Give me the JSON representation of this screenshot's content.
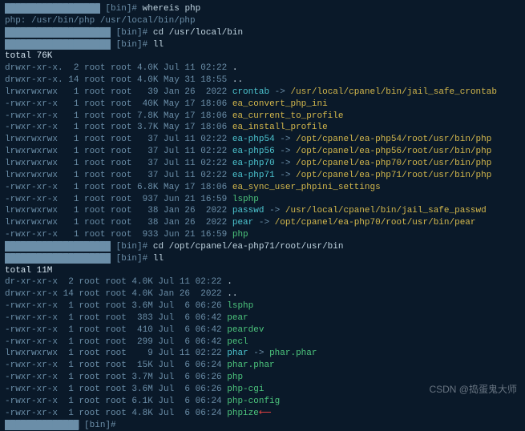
{
  "redact1": "██████████████████",
  "redact2": "████████████████████",
  "redact3": "████████████████████",
  "redact4": "██████████████",
  "redact5": "████████████████████",
  "redact6": "██████████████",
  "prompt_bin": " [bin]# ",
  "cmd_whereis": "whereis php",
  "whereis_out": "php: /usr/bin/php /usr/local/bin/php",
  "cmd_cd1": "cd /usr/local/bin",
  "cmd_ll": "ll",
  "total1": "total 76K",
  "l1": {
    "p": "drwxr-xr-x.  2 root root 4.0K Jul 11 02:22 ",
    "n": "."
  },
  "l2": {
    "p": "drwxr-xr-x. 14 root root 4.0K May 31 18:55 ",
    "n": ".."
  },
  "l3": {
    "p": "lrwxrwxrwx   1 root root   39 Jan 26  2022 ",
    "n": "crontab",
    "a": " -> ",
    "t": "/usr/local/cpanel/bin/jail_safe_crontab"
  },
  "l4": {
    "p": "-rwxr-xr-x   1 root root  40K May 17 18:06 ",
    "n": "ea_convert_php_ini"
  },
  "l5": {
    "p": "-rwxr-xr-x   1 root root 7.8K May 17 18:06 ",
    "n": "ea_current_to_profile"
  },
  "l6": {
    "p": "-rwxr-xr-x   1 root root 3.7K May 17 18:06 ",
    "n": "ea_install_profile"
  },
  "l7": {
    "p": "lrwxrwxrwx   1 root root   37 Jul 11 02:22 ",
    "n": "ea-php54",
    "a": " -> ",
    "t": "/opt/cpanel/ea-php54/root/usr/bin/php"
  },
  "l8": {
    "p": "lrwxrwxrwx   1 root root   37 Jul 11 02:22 ",
    "n": "ea-php56",
    "a": " -> ",
    "t": "/opt/cpanel/ea-php56/root/usr/bin/php"
  },
  "l9": {
    "p": "lrwxrwxrwx   1 root root   37 Jul 11 02:22 ",
    "n": "ea-php70",
    "a": " -> ",
    "t": "/opt/cpanel/ea-php70/root/usr/bin/php"
  },
  "l10": {
    "p": "lrwxrwxrwx   1 root root   37 Jul 11 02:22 ",
    "n": "ea-php71",
    "a": " -> ",
    "t": "/opt/cpanel/ea-php71/root/usr/bin/php"
  },
  "l11": {
    "p": "-rwxr-xr-x   1 root root 6.8K May 17 18:06 ",
    "n": "ea_sync_user_phpini_settings"
  },
  "l12": {
    "p": "-rwxr-xr-x   1 root root  937 Jun 21 16:59 ",
    "n": "lsphp"
  },
  "l13": {
    "p": "lrwxrwxrwx   1 root root   38 Jan 26  2022 ",
    "n": "passwd",
    "a": " -> ",
    "t": "/usr/local/cpanel/bin/jail_safe_passwd"
  },
  "l14": {
    "p": "lrwxrwxrwx   1 root root   38 Jan 26  2022 ",
    "n": "pear",
    "a": " -> ",
    "t": "/opt/cpanel/ea-php70/root/usr/bin/pear"
  },
  "l15": {
    "p": "-rwxr-xr-x   1 root root  933 Jun 21 16:59 ",
    "n": "php"
  },
  "cmd_cd2": "cd /opt/cpanel/ea-php71/root/usr/bin",
  "total2": "total 11M",
  "m1": {
    "p": "dr-xr-xr-x  2 root root 4.0K Jul 11 02:22 ",
    "n": "."
  },
  "m2": {
    "p": "drwxr-xr-x 14 root root 4.0K Jan 26  2022 ",
    "n": ".."
  },
  "m3": {
    "p": "-rwxr-xr-x  1 root root 3.6M Jul  6 06:26 ",
    "n": "lsphp"
  },
  "m4": {
    "p": "-rwxr-xr-x  1 root root  383 Jul  6 06:42 ",
    "n": "pear"
  },
  "m5": {
    "p": "-rwxr-xr-x  1 root root  410 Jul  6 06:42 ",
    "n": "peardev"
  },
  "m6": {
    "p": "-rwxr-xr-x  1 root root  299 Jul  6 06:42 ",
    "n": "pecl"
  },
  "m7": {
    "p": "lrwxrwxrwx  1 root root    9 Jul 11 02:22 ",
    "n": "phar",
    "a": " -> ",
    "t": "phar.phar"
  },
  "m8": {
    "p": "-rwxr-xr-x  1 root root  15K Jul  6 06:24 ",
    "n": "phar.phar"
  },
  "m9": {
    "p": "-rwxr-xr-x  1 root root 3.7M Jul  6 06:26 ",
    "n": "php"
  },
  "m10": {
    "p": "-rwxr-xr-x  1 root root 3.6M Jul  6 06:26 ",
    "n": "php-cgi"
  },
  "m11": {
    "p": "-rwxr-xr-x  1 root root 6.1K Jul  6 06:24 ",
    "n": "php-config"
  },
  "m12": {
    "p": "-rwxr-xr-x  1 root root 4.8K Jul  6 06:24 ",
    "n": "phpize"
  },
  "arrow": "⟵",
  "watermark": "CSDN @捣蛋鬼大师"
}
